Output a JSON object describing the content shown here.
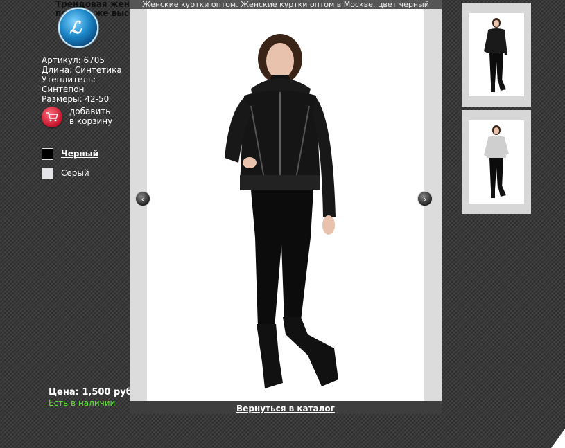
{
  "background": {
    "description_line1": "Трендовая женская куртка. Модель",
    "description_line2": "пе вная же высок"
  },
  "product": {
    "article": "Артикул: 6705",
    "length": "Длина: Синтетика",
    "insulation_label": "Утеплитель:",
    "insulation_value": "Синтепон",
    "sizes": "Размеры: 42-50",
    "cart_label_line1": "добавить",
    "cart_label_line2": "в корзину",
    "price": "Цена: 1,500 руб.",
    "stock": "Есть в наличии"
  },
  "colors": [
    {
      "label": "Черный",
      "swatch": "#000000",
      "active": true
    },
    {
      "label": "Серый",
      "swatch": "#e3e3e8",
      "active": false
    }
  ],
  "lightbox": {
    "title": "Женские куртки оптом. Женские куртки оптом в Москве. цвет черный",
    "back_link": "Вернуться в каталог",
    "prev_glyph": "‹",
    "next_glyph": "›"
  },
  "thumbnails": [
    {
      "alt": "black-jacket-thumbnail"
    },
    {
      "alt": "grey-jacket-thumbnail"
    }
  ],
  "colors_palette": {
    "stock_green": "#5fe03a",
    "lightbox_frame": "#dcdcdc",
    "cart_red": "#c4122a"
  }
}
